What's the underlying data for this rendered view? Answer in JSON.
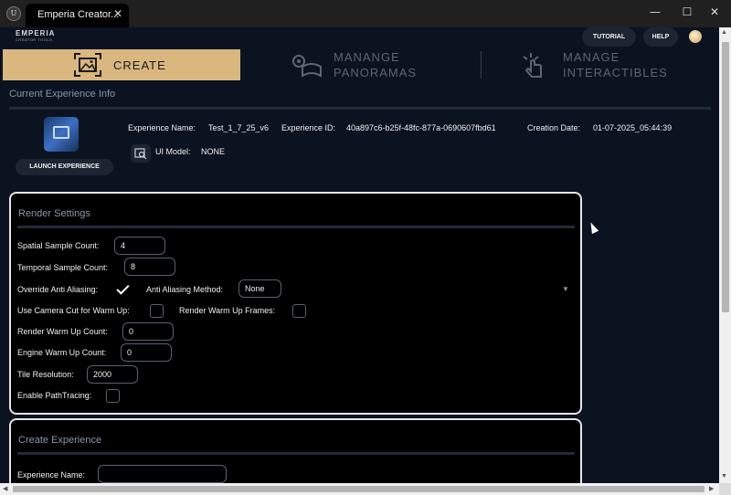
{
  "window": {
    "tab_title": "Emperia Creator...",
    "tab_close_icon": "close-icon",
    "app_icon": "unreal-logo-icon",
    "app_icon_glyph": "U",
    "minimize": "—",
    "maximize": "☐",
    "close": "✕"
  },
  "header": {
    "logo": "EMPERIA",
    "logo_sub": "CREATOR TOOLS",
    "tutorial_label": "TUTORIAL",
    "help_label": "HELP"
  },
  "nav": {
    "tabs": [
      {
        "label": "CREATE",
        "icon": "image-frame-icon",
        "active": true
      },
      {
        "label": "MANANGE\nPANORAMAS",
        "icon": "panorama-settings-icon",
        "active": false
      },
      {
        "label": "MANAGE\nINTERACTIBLES",
        "icon": "hand-tap-icon",
        "active": false
      }
    ]
  },
  "experience_info": {
    "section_title": "Current Experience Info",
    "launch_label": "LAUNCH EXPERIENCE",
    "name_label": "Experience Name:",
    "name_value": "Test_1_7_25_v6",
    "id_label": "Experience ID:",
    "id_value": "40a897c6-b25f-48fc-877a-0690607fbd61",
    "date_label": "Creation Date:",
    "date_value": "01-07-2025_05:44:39",
    "ui_model_label": "UI Model:",
    "ui_model_value": "NONE"
  },
  "render_settings": {
    "title": "Render Settings",
    "spatial_label": "Spatial Sample Count:",
    "spatial_value": "4",
    "temporal_label": "Temporal Sample Count:",
    "temporal_value": "8",
    "override_aa_label": "Override Anti Aliasing:",
    "override_aa_checked": true,
    "aa_method_label": "Anti Aliasing Method:",
    "aa_method_value": "None",
    "camera_cut_label": "Use Camera Cut for Warm Up:",
    "camera_cut_checked": false,
    "warmup_frames_label": "Render Warm Up Frames:",
    "warmup_frames_checked": false,
    "render_warmup_label": "Render Warm Up Count:",
    "render_warmup_value": "0",
    "engine_warmup_label": "Engine Warm Up Count:",
    "engine_warmup_value": "0",
    "tile_res_label": "Tile Resolution:",
    "tile_res_value": "2000",
    "pathtracing_label": "Enable PathTracing:",
    "pathtracing_checked": false
  },
  "create_experience": {
    "title": "Create Experience",
    "name_label": "Experience Name:",
    "name_value": ""
  },
  "colors": {
    "accent": "#d9b77f",
    "background": "#0b1220",
    "panel": "#000000",
    "button": "#1d2533"
  }
}
